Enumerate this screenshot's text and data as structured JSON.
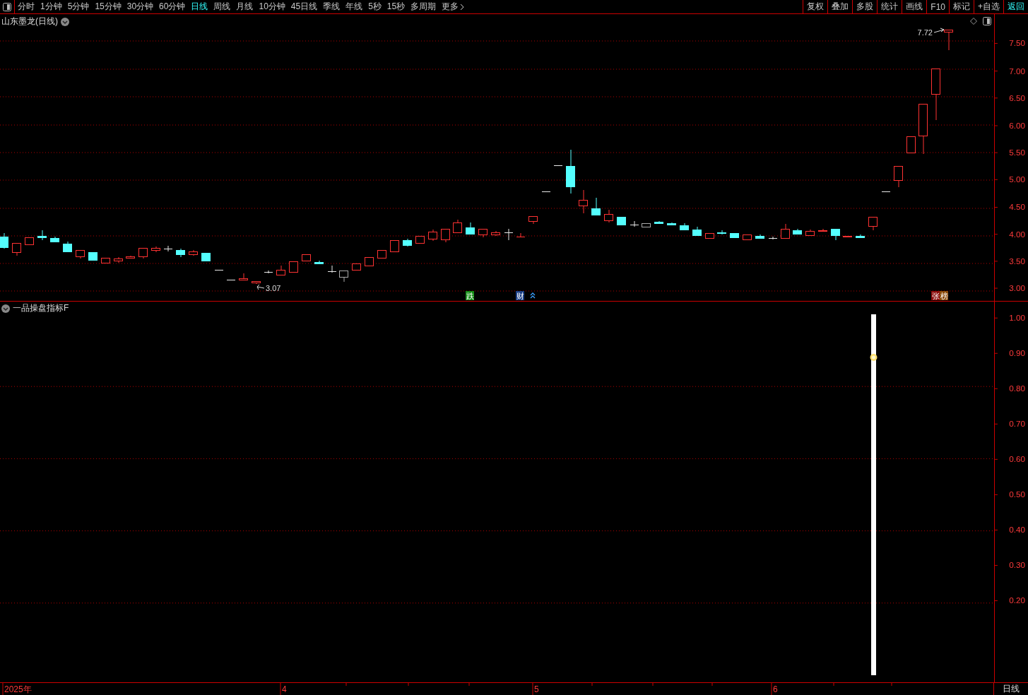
{
  "toolbar": {
    "periods": [
      {
        "label": "分时",
        "selected": false
      },
      {
        "label": "1分钟",
        "selected": false
      },
      {
        "label": "5分钟",
        "selected": false
      },
      {
        "label": "15分钟",
        "selected": false
      },
      {
        "label": "30分钟",
        "selected": false
      },
      {
        "label": "60分钟",
        "selected": false
      },
      {
        "label": "日线",
        "selected": true
      },
      {
        "label": "周线",
        "selected": false
      },
      {
        "label": "月线",
        "selected": false
      },
      {
        "label": "10分钟",
        "selected": false
      },
      {
        "label": "45日线",
        "selected": false
      },
      {
        "label": "季线",
        "selected": false
      },
      {
        "label": "年线",
        "selected": false
      },
      {
        "label": "5秒",
        "selected": false
      },
      {
        "label": "15秒",
        "selected": false
      },
      {
        "label": "多周期",
        "selected": false
      },
      {
        "label": "更多",
        "selected": false
      }
    ],
    "tools": [
      {
        "label": "复权",
        "selected": false
      },
      {
        "label": "叠加",
        "selected": false
      },
      {
        "label": "多股",
        "selected": false
      },
      {
        "label": "统计",
        "selected": false
      },
      {
        "label": "画线",
        "selected": false
      },
      {
        "label": "F10",
        "selected": false
      },
      {
        "label": "标记",
        "selected": false
      },
      {
        "label": "+自选",
        "selected": false
      },
      {
        "label": "返回",
        "selected": true
      }
    ]
  },
  "main_chart": {
    "title": "山东墨龙(日线)",
    "price_ticks": [
      "7.50",
      "7.00",
      "6.50",
      "6.00",
      "5.50",
      "5.00",
      "4.50",
      "4.00",
      "3.50",
      "3.00"
    ],
    "high_label": "7.72",
    "low_label": "3.07",
    "markers": [
      {
        "kind": "tag",
        "text": "跌",
        "color": "#138a13"
      },
      {
        "kind": "tag",
        "text": "财",
        "color": "#1c3f86"
      },
      {
        "kind": "arrow"
      },
      {
        "kind": "tag",
        "text": "张",
        "color": "#8a0a0a"
      },
      {
        "kind": "tag",
        "text": "榜",
        "color": "#8a4a08"
      }
    ]
  },
  "indicator": {
    "title": "一品操盘指标F",
    "ticks": [
      "1.00",
      "0.90",
      "0.80",
      "0.70",
      "0.60",
      "0.50",
      "0.40",
      "0.30",
      "0.20"
    ]
  },
  "time_axis": {
    "labels": [
      "2025年",
      "4",
      "5",
      "6"
    ],
    "period": "日线"
  }
}
